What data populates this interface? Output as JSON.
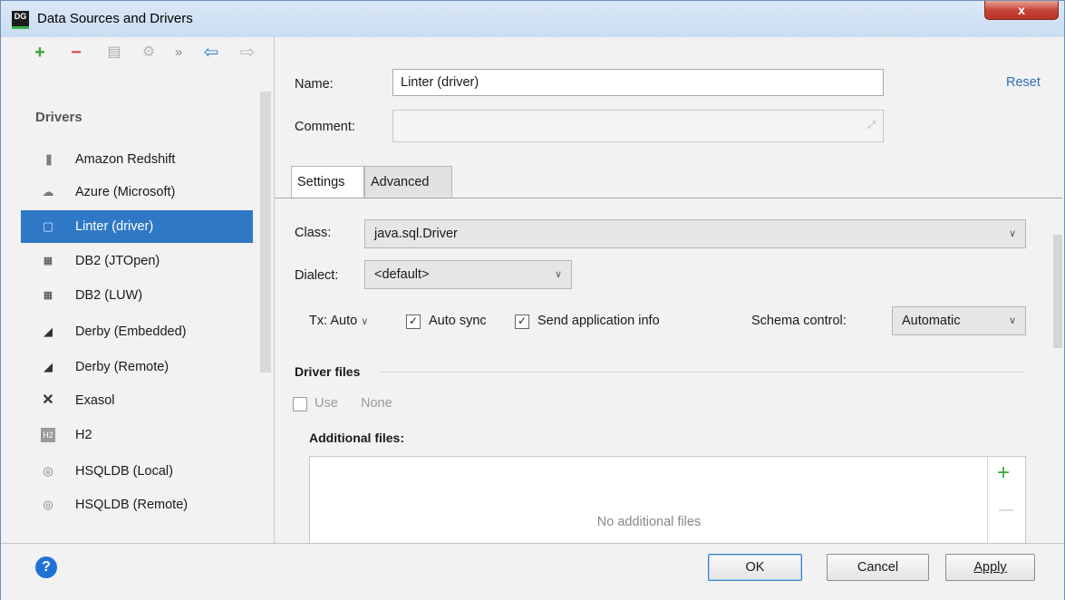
{
  "window": {
    "title": "Data Sources and Drivers",
    "app_icon_text": "DG",
    "close_glyph": "x"
  },
  "left_toolbar": {
    "add": "+",
    "remove": "−",
    "copy": "▤",
    "tool": "⚙",
    "more": "»",
    "back": "⇦",
    "forward": "⇨"
  },
  "drivers": {
    "heading": "Drivers",
    "items": [
      {
        "label": "Amazon Redshift",
        "icon": "redshift-icon"
      },
      {
        "label": "Azure (Microsoft)",
        "icon": "azure-cloud-icon"
      },
      {
        "label": "Linter (driver)",
        "icon": "linter-icon"
      },
      {
        "label": "DB2 (JTOpen)",
        "icon": "ibm-db2-icon"
      },
      {
        "label": "DB2 (LUW)",
        "icon": "ibm-db2-icon"
      },
      {
        "label": "Derby (Embedded)",
        "icon": "derby-hat-icon"
      },
      {
        "label": "Derby (Remote)",
        "icon": "derby-hat-icon"
      },
      {
        "label": "Exasol",
        "icon": "exasol-x-icon"
      },
      {
        "label": "H2",
        "icon": "h2-icon"
      },
      {
        "label": "HSQLDB (Local)",
        "icon": "hsqldb-icon"
      },
      {
        "label": "HSQLDB (Remote)",
        "icon": "hsqldb-icon"
      }
    ],
    "selected_index": 2
  },
  "form": {
    "name_label": "Name:",
    "name_value": "Linter (driver)",
    "comment_label": "Comment:",
    "comment_value": "",
    "reset_label": "Reset",
    "tabs": [
      "Settings",
      "Advanced"
    ],
    "class_label": "Class:",
    "class_value": "java.sql.Driver",
    "dialect_label": "Dialect:",
    "dialect_value": "<default>",
    "tx_label": "Tx: Auto",
    "auto_sync_label": "Auto sync",
    "send_info_label": "Send application info",
    "schema_control_label": "Schema control:",
    "schema_control_value": "Automatic",
    "driver_files_heading": "Driver files",
    "use_label": "Use",
    "use_value": "None",
    "additional_files_label": "Additional files:",
    "no_files_text": "No additional files",
    "add_file": "+",
    "remove_file": "—"
  },
  "buttons": {
    "help": "?",
    "ok": "OK",
    "cancel": "Cancel",
    "apply": "Apply"
  },
  "colors": {
    "selection": "#2f78c6",
    "link": "#2f6fb8",
    "add_green": "#3aa635",
    "remove_red": "#d44",
    "arrow_blue": "#2f86d6"
  }
}
